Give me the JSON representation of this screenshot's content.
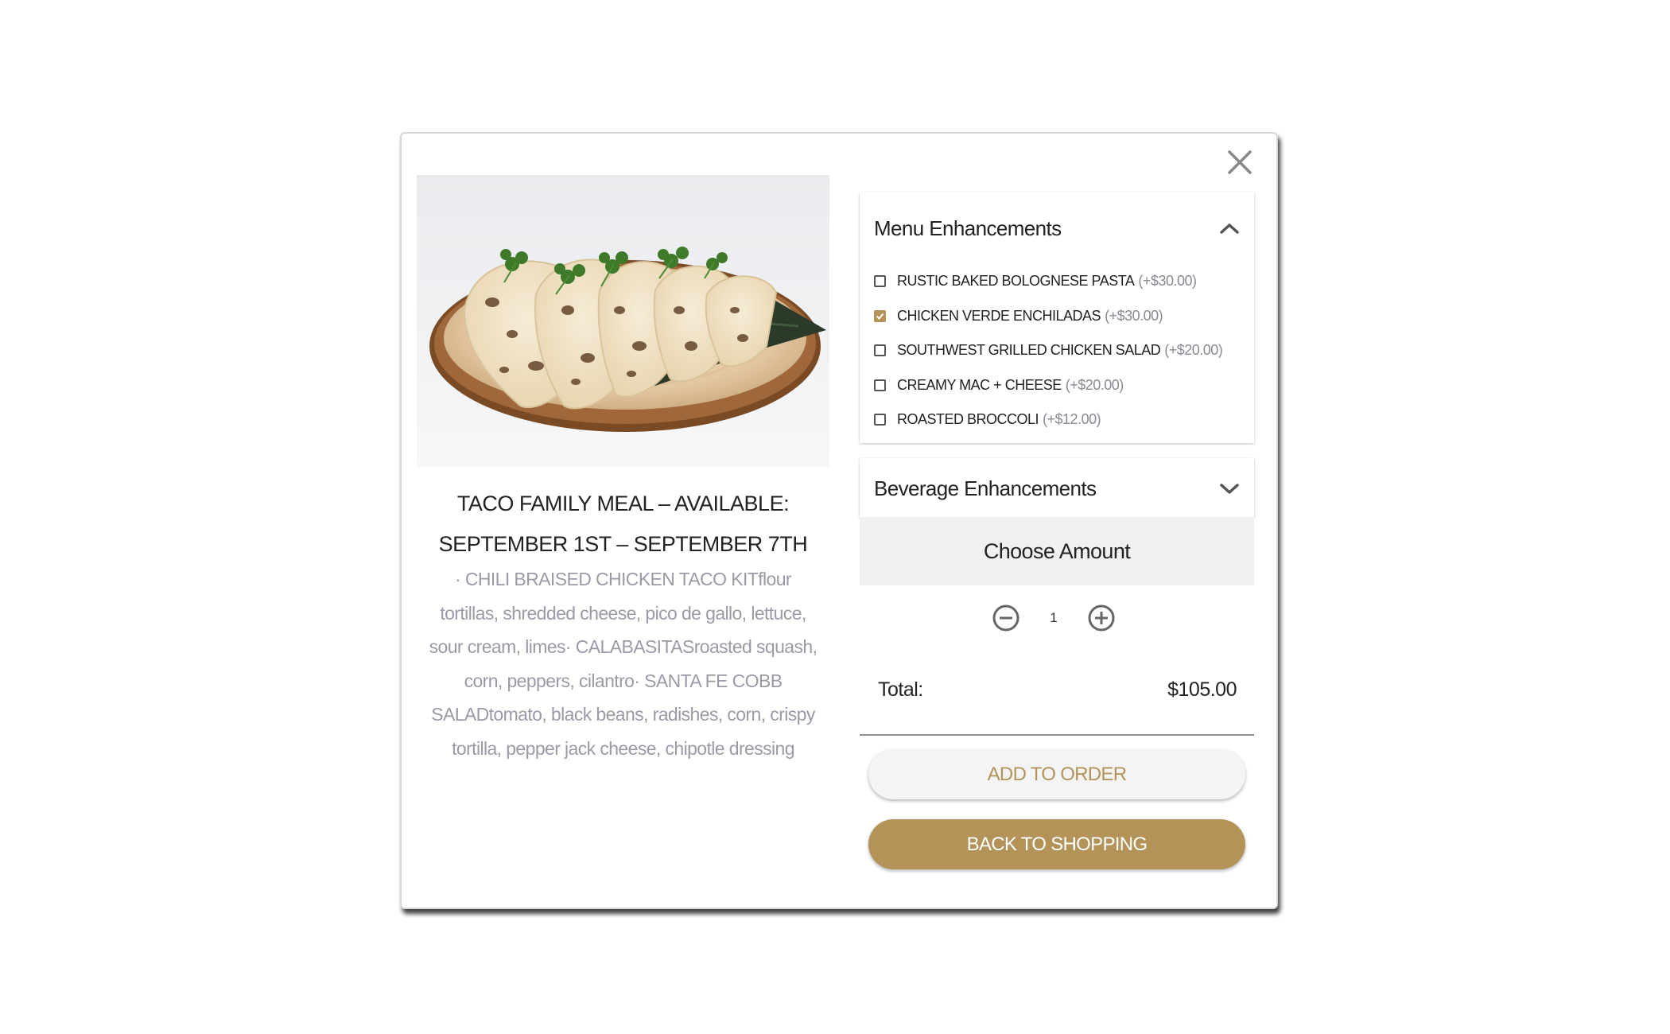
{
  "modal": {
    "close_icon": "close-icon"
  },
  "product": {
    "image_icon": "taco-platter-photo",
    "title": "TACO FAMILY MEAL – AVAILABLE: SEPTEMBER 1ST – SEPTEMBER 7TH",
    "description": "· CHILI BRAISED CHICKEN TACO KITflour tortillas, shredded cheese, pico de gallo, lettuce, sour cream, limes· CALABASITASroasted squash, corn, peppers, cilantro· SANTA FE COBB SALADtomato, black beans, radishes, corn, crispy tortilla, pepper jack cheese, chipotle dressing"
  },
  "menu_enhancements": {
    "title": "Menu Enhancements",
    "expanded": true,
    "toggle_icon": "chevron-up-icon",
    "options": [
      {
        "name": "RUSTIC BAKED BOLOGNESE PASTA",
        "price": "(+$30.00)",
        "checked": false
      },
      {
        "name": "CHICKEN VERDE ENCHILADAS",
        "price": "(+$30.00)",
        "checked": true
      },
      {
        "name": "SOUTHWEST GRILLED CHICKEN SALAD",
        "price": "(+$20.00)",
        "checked": false
      },
      {
        "name": "CREAMY MAC + CHEESE",
        "price": "(+$20.00)",
        "checked": false
      },
      {
        "name": "ROASTED BROCCOLI",
        "price": "(+$12.00)",
        "checked": false
      }
    ]
  },
  "beverage_enhancements": {
    "title": "Beverage Enhancements",
    "expanded": false,
    "toggle_icon": "chevron-down-icon"
  },
  "amount": {
    "label": "Choose Amount",
    "quantity": "1",
    "decrement_icon": "minus-circle-icon",
    "increment_icon": "plus-circle-icon"
  },
  "total": {
    "label": "Total:",
    "value": "$105.00"
  },
  "buttons": {
    "add_to_order": "ADD TO ORDER",
    "back_to_shopping": "BACK TO SHOPPING"
  },
  "colors": {
    "accent_gold": "#b39358",
    "muted_text": "#9a9aa8",
    "panel_gray": "#eff0f2"
  }
}
